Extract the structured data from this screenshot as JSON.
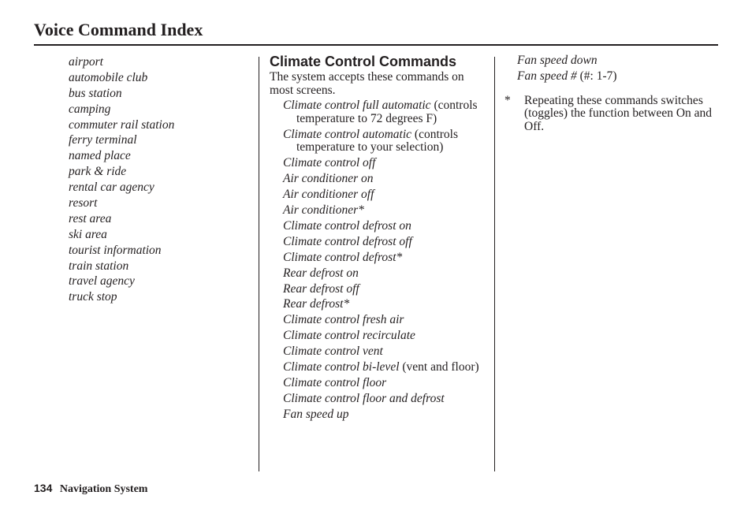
{
  "header": {
    "title": "Voice Command Index"
  },
  "places": [
    "airport",
    "automobile club",
    "bus station",
    "camping",
    "commuter rail station",
    "ferry terminal",
    "named place",
    "park & ride",
    "rental car agency",
    "resort",
    "rest area",
    "ski area",
    "tourist information",
    "train station",
    "travel agency",
    "truck stop"
  ],
  "climate": {
    "heading": "Climate Control Commands",
    "intro": "The system accepts these commands on most screens.",
    "commands": [
      {
        "cmd": "Climate control full automatic",
        "note": "(controls temperature to 72 degrees F)"
      },
      {
        "cmd": "Climate control automatic",
        "note": "(controls temperature to your selection)"
      },
      {
        "cmd": "Climate control off"
      },
      {
        "cmd": "Air conditioner on"
      },
      {
        "cmd": "Air conditioner off"
      },
      {
        "cmd": "Air conditioner*"
      },
      {
        "cmd": "Climate control defrost on"
      },
      {
        "cmd": "Climate control defrost off"
      },
      {
        "cmd": "Climate control defrost*"
      },
      {
        "cmd": "Rear defrost on"
      },
      {
        "cmd": "Rear defrost off"
      },
      {
        "cmd": "Rear defrost*"
      },
      {
        "cmd": "Climate control fresh air"
      },
      {
        "cmd": "Climate control recirculate"
      },
      {
        "cmd": "Climate control vent"
      },
      {
        "cmd": "Climate control bi-level",
        "note": "(vent and floor)"
      },
      {
        "cmd": "Climate control floor"
      },
      {
        "cmd": "Climate control floor and defrost"
      },
      {
        "cmd": "Fan speed up"
      }
    ],
    "continued": [
      {
        "cmd": "Fan speed down"
      },
      {
        "cmd": "Fan speed #",
        "note": "(#: 1-7)"
      }
    ],
    "footnote": {
      "mark": "*",
      "text": "Repeating these commands switches (toggles) the function between On and Off."
    }
  },
  "footer": {
    "page_number": "134",
    "section": "Navigation System"
  }
}
